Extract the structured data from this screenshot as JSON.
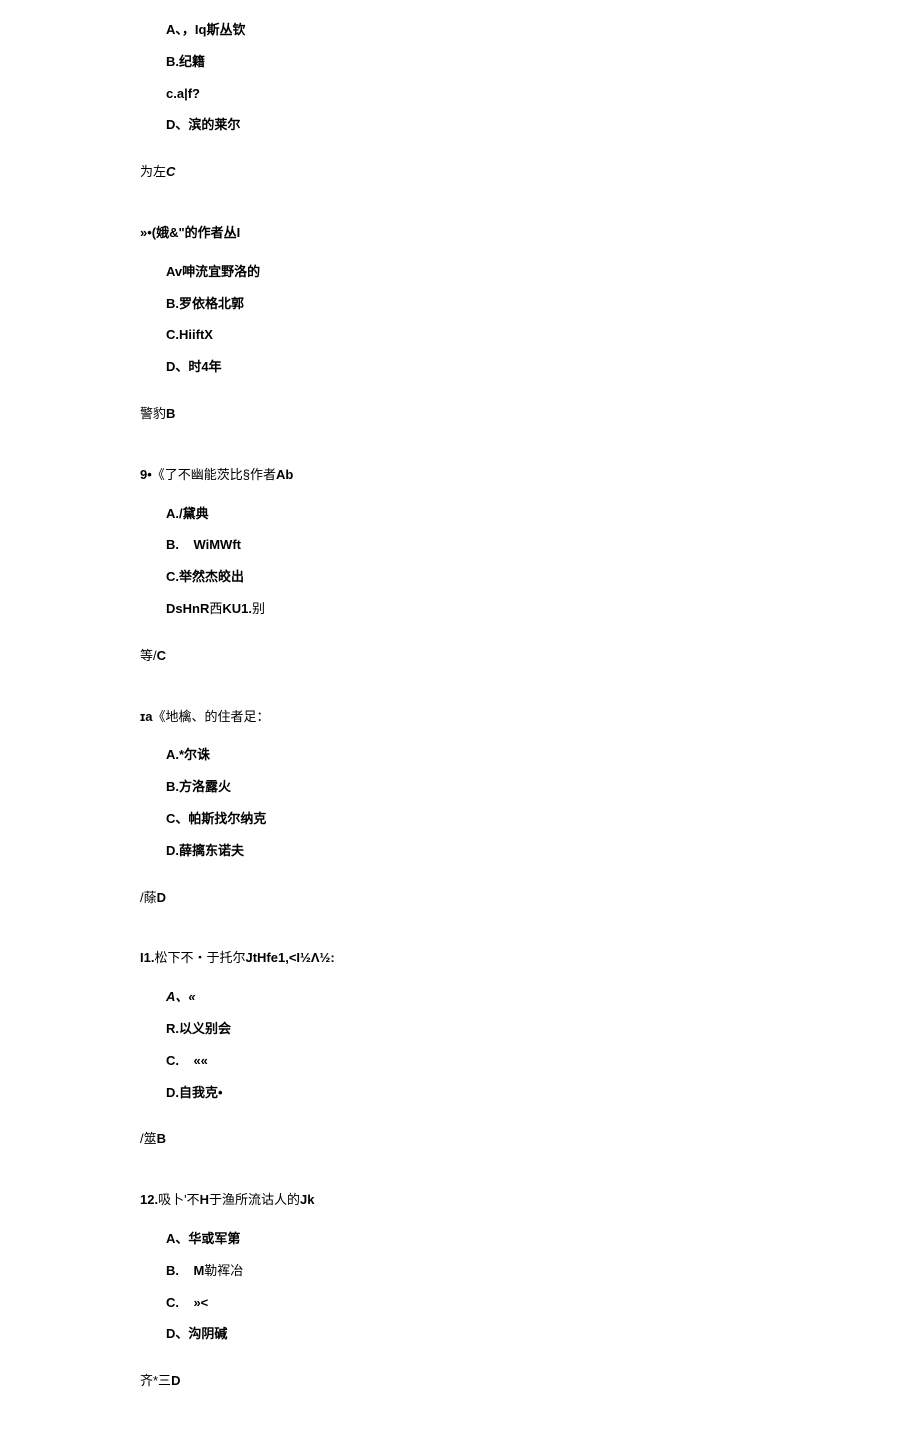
{
  "q7": {
    "optA": "A、，Iq斯丛钦",
    "optB": "B.纪籍",
    "optC": "c.a|f?",
    "optD": "D、滨的莱尔",
    "answerPrefix": "为左",
    "answerLetter": "C"
  },
  "q8": {
    "stem": "»•(娥&\"的作者丛I",
    "optA": "Av呻㳘宜野洛的",
    "optB": "B.罗依格北郭",
    "optC": "C.HiiftX",
    "optD": "D、时4年",
    "answerPrefix": "警豹",
    "answerLetter": "B"
  },
  "q9": {
    "stemPrefix": "9•",
    "stemText": "《了不幽能茨比§作者",
    "stemSuffix": "Ab",
    "optA": "A./黛典",
    "optBPrefix": "B.",
    "optBText": "WiMWft",
    "optC": "C.举然杰皎出",
    "optDPrefix": "DsHnR",
    "optDMid": "西",
    "optDSuffix": "KU1.",
    "optDEnd": "别",
    "answerPrefix": "等/",
    "answerLetter": "C"
  },
  "q10": {
    "stemPrefix": "ɪa",
    "stemText": "《地檎、的住者足：",
    "optA": "A.*尔诛",
    "optB": "B.方洛露火",
    "optC": "C、帕斯找尔纳克",
    "optD": "D.薛摛东诺夫",
    "answerPrefix": "/蒢",
    "answerLetter": "D"
  },
  "q11": {
    "stemPrefix": "I1.",
    "stemText": "松下不・于托尔",
    "stemMid": "JtHfe1,<I½Λ½:",
    "optA": "A、«",
    "optB": "R.以义别会",
    "optCPrefix": "C.",
    "optCText": "««",
    "optD": "D.自我克•",
    "answerPrefix": "/筮",
    "answerLetter": "B"
  },
  "q12": {
    "stemPrefix": "12.",
    "stemText": "吸卜'不",
    "stemMid": "H",
    "stemText2": "于渔所流诂人的",
    "stemSuffix": "Jk",
    "optA": "A、华或军第",
    "optBPrefix": "B.",
    "optBMid": "M",
    "optBText": "勒裈冶",
    "optCPrefix": "C.",
    "optCText": "»<",
    "optD": "D、沟阴碱",
    "answerPrefix": "齐*三",
    "answerLetter": "D"
  }
}
